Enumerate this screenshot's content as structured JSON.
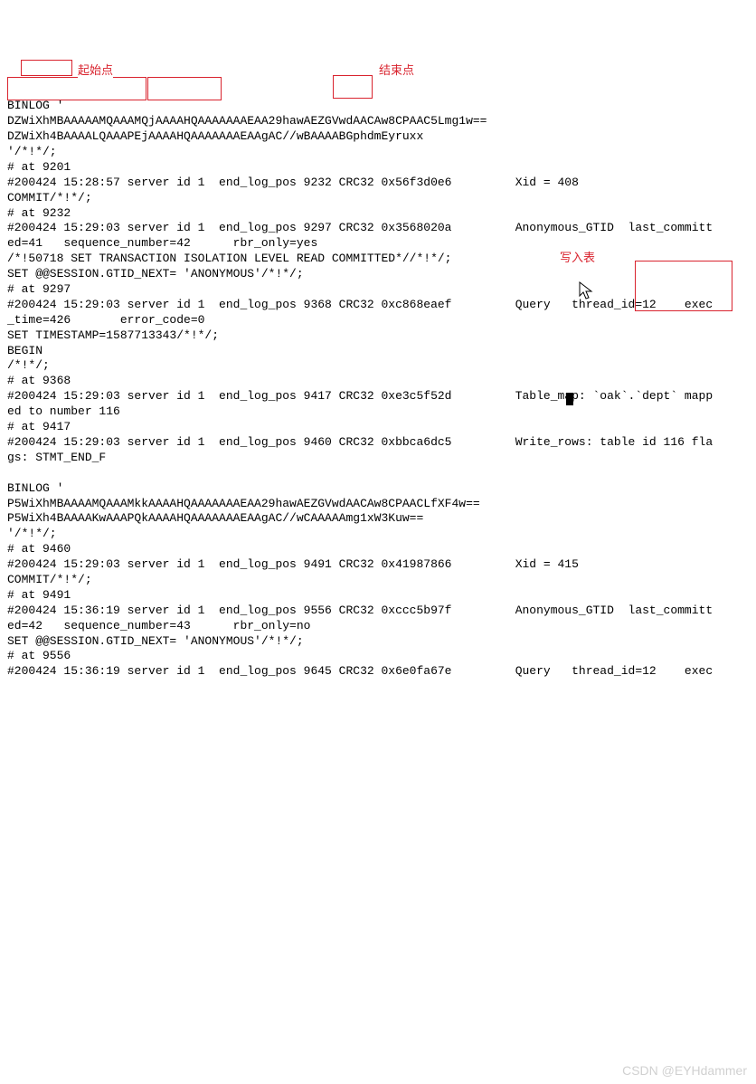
{
  "lines": [
    "BINLOG '",
    "DZWiXhMBAAAAAMQAAAMQjAAAAHQAAAAAAAEAA29hawAEZGVwdAACAw8CPAAC5Lmg1w==",
    "DZWiXh4BAAAALQAAAPEjAAAAHQAAAAAAAEAAgAC//wBAAAABGphdmEyruxx",
    "'/*!*/;",
    "# at 9201",
    "#200424 15:28:57 server id 1  end_log_pos 9232 CRC32 0x56f3d0e6         Xid = 408",
    "COMMIT/*!*/;",
    "# at 9232",
    "#200424 15:29:03 server id 1  end_log_pos 9297 CRC32 0x3568020a         Anonymous_GTID  last_committ",
    "ed=41   sequence_number=42      rbr_only=yes",
    "/*!50718 SET TRANSACTION ISOLATION LEVEL READ COMMITTED*//*!*/;",
    "SET @@SESSION.GTID_NEXT= 'ANONYMOUS'/*!*/;",
    "# at 9297",
    "#200424 15:29:03 server id 1  end_log_pos 9368 CRC32 0xc868eaef         Query   thread_id=12    exec",
    "_time=426       error_code=0",
    "SET TIMESTAMP=1587713343/*!*/;",
    "BEGIN",
    "/*!*/;",
    "# at 9368",
    "#200424 15:29:03 server id 1  end_log_pos 9417 CRC32 0xe3c5f52d         Table_map: `oak`.`dept` mapp",
    "ed to number 116",
    "# at 9417",
    "#200424 15:29:03 server id 1  end_log_pos 9460 CRC32 0xbbca6dc5         Write_rows: table id 116 fla",
    "gs: STMT_END_F",
    "",
    "BINLOG '",
    "P5WiXhMBAAAAMQAAAMkkAAAAHQAAAAAAAEAA29hawAEZGVwdAACAw8CPAACLfXF4w==",
    "P5WiXh4BAAAAKwAAAPQkAAAAHQAAAAAAAEAAgAC//wCAAAAAmg1xW3Kuw==",
    "'/*!*/;",
    "# at 9460",
    "#200424 15:29:03 server id 1  end_log_pos 9491 CRC32 0x41987866         Xid = 415",
    "COMMIT/*!*/;",
    "# at 9491",
    "#200424 15:36:19 server id 1  end_log_pos 9556 CRC32 0xccc5b97f         Anonymous_GTID  last_committ",
    "ed=42   sequence_number=43      rbr_only=no",
    "SET @@SESSION.GTID_NEXT= 'ANONYMOUS'/*!*/;",
    "# at 9556",
    "#200424 15:36:19 server id 1  end_log_pos 9645 CRC32 0x6e0fa67e         Query   thread_id=12    exec"
  ],
  "annotations": {
    "start_label": "起始点",
    "end_label": "结束点",
    "write_table_label": "写入表"
  },
  "watermark": "CSDN @EYHdammer"
}
